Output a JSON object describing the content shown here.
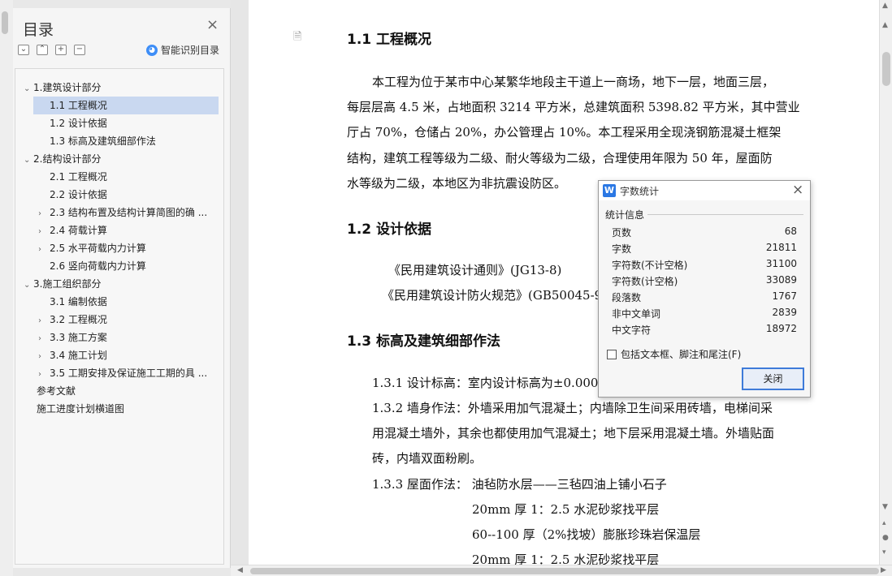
{
  "toc": {
    "title": "目录",
    "close_symbol": "×",
    "tools": [
      "⌄",
      "⌃",
      "+",
      "−"
    ],
    "smart_label": "智能识别目录",
    "items": [
      {
        "label": "1.建筑设计部分",
        "caret": "⌄"
      },
      {
        "label": "1.1 工程概况",
        "caret": ""
      },
      {
        "label": "1.2 设计依据",
        "caret": ""
      },
      {
        "label": "1.3 标高及建筑细部作法",
        "caret": ""
      },
      {
        "label": "2.结构设计部分",
        "caret": "⌄"
      },
      {
        "label": "2.1 工程概况",
        "caret": ""
      },
      {
        "label": "2.2 设计依据",
        "caret": ""
      },
      {
        "label": "2.3 结构布置及结构计算简图的确 ...",
        "caret": "›"
      },
      {
        "label": "2.4 荷载计算",
        "caret": "›"
      },
      {
        "label": "2.5 水平荷载内力计算",
        "caret": "›"
      },
      {
        "label": "2.6 竖向荷载内力计算",
        "caret": ""
      },
      {
        "label": "3.施工组织部分",
        "caret": "⌄"
      },
      {
        "label": "3.1 编制依据",
        "caret": ""
      },
      {
        "label": "3.2 工程概况",
        "caret": "›"
      },
      {
        "label": "3.3 施工方案",
        "caret": "›"
      },
      {
        "label": "3.4 施工计划",
        "caret": "›"
      },
      {
        "label": "3.5 工期安排及保证施工工期的具 ...",
        "caret": "›"
      },
      {
        "label": "参考文献",
        "caret": ""
      },
      {
        "label": "施工进度计划横道图",
        "caret": ""
      }
    ]
  },
  "doc": {
    "page_icon": "🗎",
    "h1": "1.1 工程概况",
    "para1": [
      "本工程为位于某市中心某繁华地段主干道上一商场，地下一层，地面三层，",
      "每层层高 4.5 米，占地面积 3214 平方米，总建筑面积 5398.82 平方米，其中营业",
      "厅占 70%，仓储占 20%，办公管理占 10%。本工程采用全现浇钢筋混凝土框架",
      "结构，建筑工程等级为二级、耐火等级为二级，合理使用年限为 50 年，屋面防",
      "水等级为二级，本地区为非抗震设防区。"
    ],
    "h2": "1.2 设计依据",
    "refs": [
      "《民用建筑设计通则》(JG13-8)",
      "《民用建筑设计防火规范》(GB50045-9"
    ],
    "h3": "1.3 标高及建筑细部作法",
    "lines": [
      "1.3.1 设计标高：室内设计标高为±0.000,",
      "1.3.2 墙身作法：外墙采用加气混凝土；内墙除卫生间采用砖墙，电梯间采",
      "用混凝土墙外，其余也都使用加气混凝土；地下层采用混凝土墙。外墙贴面",
      "砖，内墙双面粉刷。",
      "1.3.3 屋面作法：  油毡防水层——三毡四油上铺小石子",
      "20mm 厚 1：2.5 水泥砂浆找平层",
      "60--100 厚（2%找坡）膨胀珍珠岩保温层",
      "20mm 厚 1：2.5 水泥砂浆找平层"
    ]
  },
  "dialog": {
    "app_icon": "W",
    "title": "字数统计",
    "close_symbol": "×",
    "group_label": "统计信息",
    "stats": [
      {
        "label": "页数",
        "value": "68"
      },
      {
        "label": "字数",
        "value": "21811"
      },
      {
        "label": "字符数(不计空格)",
        "value": "31100"
      },
      {
        "label": "字符数(计空格)",
        "value": "33089"
      },
      {
        "label": "段落数",
        "value": "1767"
      },
      {
        "label": "非中文单词",
        "value": "2839"
      },
      {
        "label": "中文字符",
        "value": "18972"
      }
    ],
    "checkbox_label": "包括文本框、脚注和尾注(F)",
    "close_button": "关闭"
  },
  "colors": {
    "selected_bg": "#c9d8f0",
    "accent": "#3e7bd9"
  }
}
